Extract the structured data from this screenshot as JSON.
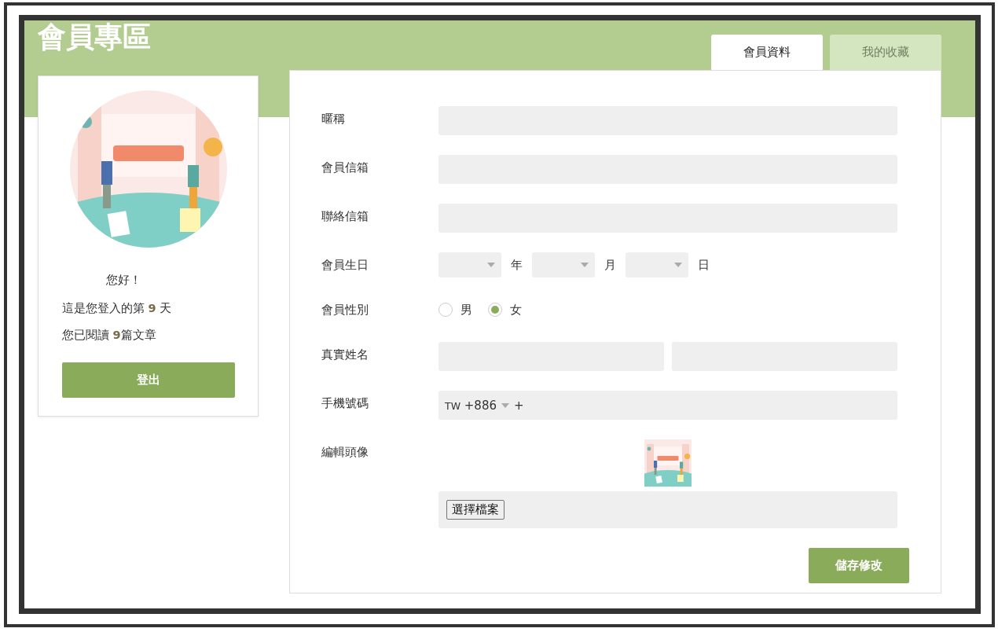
{
  "page_title": "會員專區",
  "tabs": [
    {
      "label": "會員資料",
      "selected": true
    },
    {
      "label": "我的收藏",
      "selected": false
    }
  ],
  "profile": {
    "greeting": "您好！",
    "login_days": "這是您登入的第 **9** 天",
    "articles_read": "您已閱讀 **9**篇文章",
    "logout_button": "登出"
  },
  "form": {
    "rows": [
      {
        "kind": "text",
        "label": "暱稱"
      },
      {
        "kind": "text",
        "label": "會員信箱"
      },
      {
        "kind": "text",
        "label": "聯絡信箱"
      },
      {
        "kind": "date",
        "label": "會員生日",
        "units": [
          "年",
          "月",
          "日"
        ]
      },
      {
        "kind": "radio",
        "label": "會員性別",
        "options": [
          {
            "label": "男",
            "selected": false
          },
          {
            "label": "女",
            "selected": true
          }
        ]
      },
      {
        "kind": "name",
        "label": "真實姓名"
      },
      {
        "kind": "phone",
        "label": "手機號碼",
        "country": "TW",
        "code": "+886",
        "prefix": "+"
      },
      {
        "kind": "avatar",
        "label": "編輯頭像",
        "file_button": "選擇檔案"
      }
    ],
    "save_button": "儲存修改"
  }
}
